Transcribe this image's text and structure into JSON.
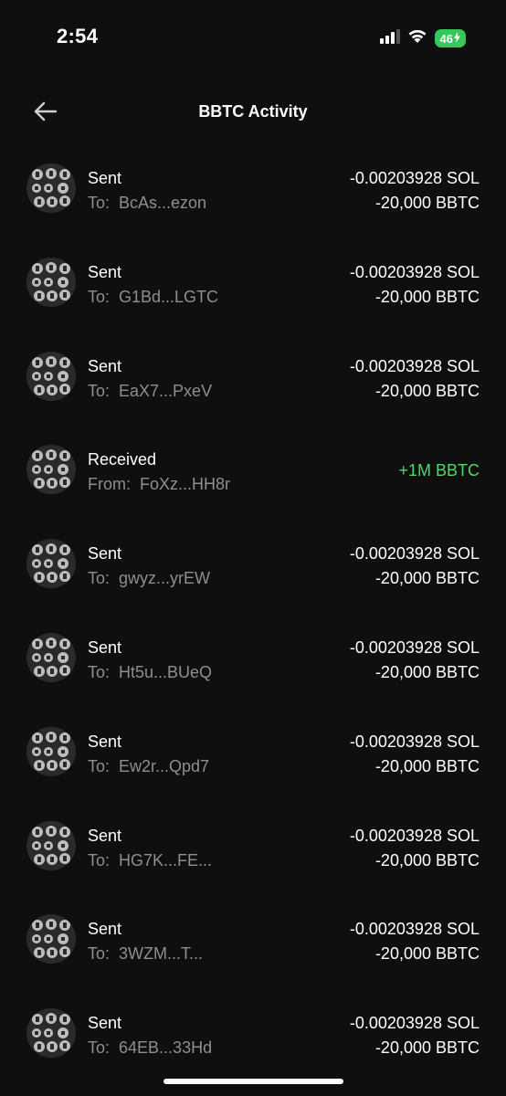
{
  "status_bar": {
    "time": "2:54",
    "battery": "46"
  },
  "header": {
    "title": "BBTC Activity",
    "back_icon": "arrow-left-icon"
  },
  "avatar_icon": "bbtc-token-icon",
  "colors": {
    "background": "#0f0f0f",
    "secondary_text": "#8e8e93",
    "positive": "#4cd964",
    "battery": "#34c759"
  },
  "transactions": [
    {
      "type": "Sent",
      "label": "To:",
      "address": "BcAs...ezon",
      "amount_sol": "-0.00203928 SOL",
      "amount_token": "-20,000 BBTC"
    },
    {
      "type": "Sent",
      "label": "To:",
      "address": "G1Bd...LGTC",
      "amount_sol": "-0.00203928 SOL",
      "amount_token": "-20,000 BBTC"
    },
    {
      "type": "Sent",
      "label": "To:",
      "address": "EaX7...PxeV",
      "amount_sol": "-0.00203928 SOL",
      "amount_token": "-20,000 BBTC"
    },
    {
      "type": "Received",
      "label": "From:",
      "address": "FoXz...HH8r",
      "amount": "+1M BBTC"
    },
    {
      "type": "Sent",
      "label": "To:",
      "address": "gwyz...yrEW",
      "amount_sol": "-0.00203928 SOL",
      "amount_token": "-20,000 BBTC"
    },
    {
      "type": "Sent",
      "label": "To:",
      "address": "Ht5u...BUeQ",
      "amount_sol": "-0.00203928 SOL",
      "amount_token": "-20,000 BBTC"
    },
    {
      "type": "Sent",
      "label": "To:",
      "address": "Ew2r...Qpd7",
      "amount_sol": "-0.00203928 SOL",
      "amount_token": "-20,000 BBTC"
    },
    {
      "type": "Sent",
      "label": "To:",
      "address": "HG7K...FE...",
      "amount_sol": "-0.00203928 SOL",
      "amount_token": "-20,000 BBTC"
    },
    {
      "type": "Sent",
      "label": "To:",
      "address": "3WZM...T...",
      "amount_sol": "-0.00203928 SOL",
      "amount_token": "-20,000 BBTC"
    },
    {
      "type": "Sent",
      "label": "To:",
      "address": "64EB...33Hd",
      "amount_sol": "-0.00203928 SOL",
      "amount_token": "-20,000 BBTC"
    }
  ]
}
